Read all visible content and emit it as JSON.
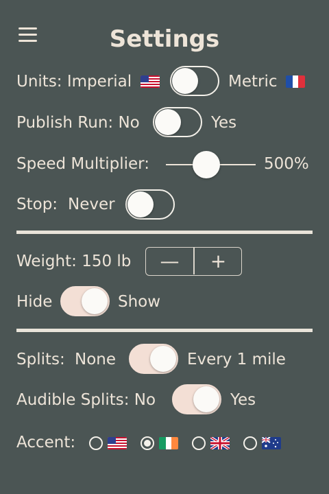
{
  "header": {
    "title": "Settings",
    "menu_icon": "hamburger-menu-icon"
  },
  "units": {
    "left_label": "Units: Imperial",
    "right_label": "Metric",
    "left_flag": "us-flag-icon",
    "right_flag": "france-flag-icon",
    "toggle_on": false
  },
  "publish": {
    "left_label": "Publish Run: No",
    "right_label": "Yes",
    "toggle_on": false
  },
  "speed": {
    "label": "Speed Multiplier:",
    "value_label": "500%",
    "slider_fraction": 0.45
  },
  "stop": {
    "label": "Stop:",
    "value_label": "Never",
    "toggle_on": false
  },
  "weight": {
    "label": "Weight: 150 lb",
    "decrement": "—",
    "increment": "+"
  },
  "visibility": {
    "left_label": "Hide",
    "right_label": "Show",
    "toggle_on": true
  },
  "splits": {
    "label": "Splits:",
    "left_label": "None",
    "right_label": "Every 1 mile",
    "toggle_on": true
  },
  "audible": {
    "left_label": "Audible Splits: No",
    "right_label": "Yes",
    "toggle_on": true
  },
  "accent": {
    "label": "Accent:",
    "options": [
      {
        "flag": "us-flag-icon",
        "selected": false
      },
      {
        "flag": "ireland-flag-icon",
        "selected": true
      },
      {
        "flag": "uk-flag-icon",
        "selected": false
      },
      {
        "flag": "australia-flag-icon",
        "selected": false
      }
    ]
  },
  "colors": {
    "background": "#4b5554",
    "text": "#ede4d8",
    "toggle_on": "#f3dfd5",
    "divider": "#e9e4da"
  }
}
